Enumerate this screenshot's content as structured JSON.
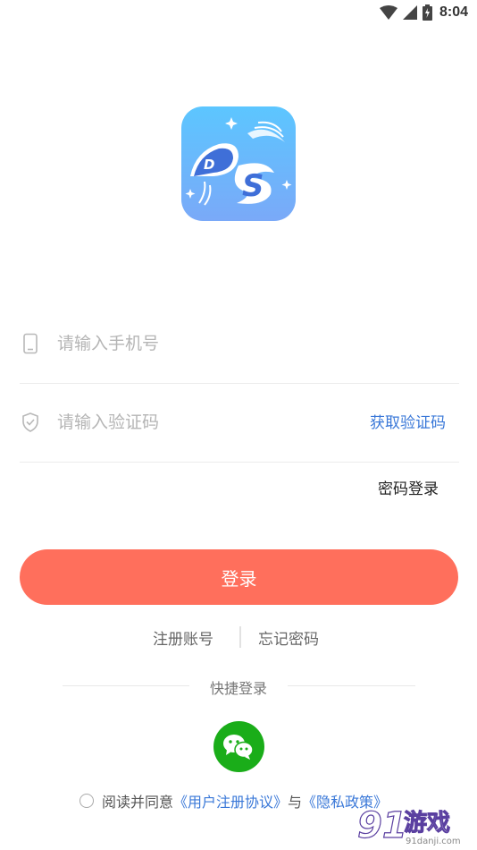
{
  "status_bar": {
    "time": "8:04",
    "icons": [
      "wifi-icon",
      "signal-icon",
      "battery-icon"
    ]
  },
  "logo": {
    "text": "DS",
    "icon": "app-logo-icon"
  },
  "form": {
    "phone": {
      "placeholder": "请输入手机号",
      "value": "",
      "icon": "phone-icon"
    },
    "code": {
      "placeholder": "请输入验证码",
      "value": "",
      "icon": "shield-icon"
    },
    "get_code_label": "获取验证码",
    "password_login_label": "密码登录"
  },
  "login_button_label": "登录",
  "links": {
    "register": "注册账号",
    "forgot": "忘记密码"
  },
  "quick_login": {
    "label": "快捷登录",
    "icon": "wechat-icon"
  },
  "agreement": {
    "prefix": "阅读并同意",
    "user_agreement": "《用户注册协议》",
    "connector": "与",
    "privacy_policy": "《隐私政策》",
    "checked": false
  },
  "watermark": {
    "brand": "91",
    "text": "游戏",
    "url": "91danji.com"
  },
  "colors": {
    "accent": "#ff6f5c",
    "link": "#3a78d8",
    "wechat": "#1aad19",
    "logo_bg": "#72bff7"
  }
}
